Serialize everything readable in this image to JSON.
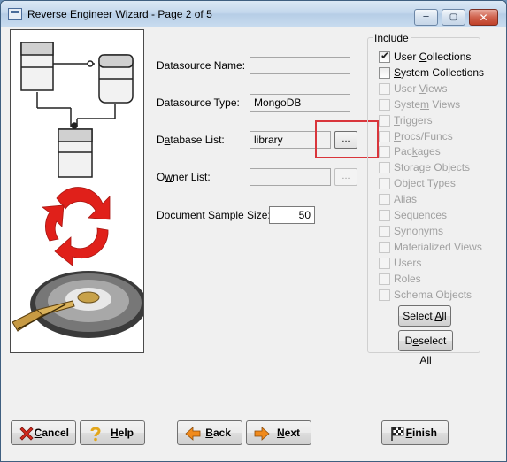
{
  "window": {
    "title": "Reverse Engineer Wizard - Page 2 of 5",
    "controls": {
      "minimize": "─",
      "maximize": "▢",
      "close": "✕"
    }
  },
  "form": {
    "datasource_name": {
      "label": "Datasource Name:",
      "value": ""
    },
    "datasource_type": {
      "label": "Datasource Type:",
      "value": "MongoDB"
    },
    "database_list": {
      "label_pre": "D",
      "label_u": "a",
      "label_post": "tabase List:",
      "value": "library",
      "browse": "..."
    },
    "owner_list": {
      "label_pre": "O",
      "label_u": "w",
      "label_post": "ner List:",
      "value": "",
      "browse": "..."
    },
    "sample_size": {
      "label": "Document Sample Size:",
      "value": "50"
    }
  },
  "include": {
    "title": "Include",
    "items": [
      {
        "pre": "User ",
        "u": "C",
        "post": "ollections",
        "checked": true,
        "enabled": true
      },
      {
        "pre": "",
        "u": "S",
        "post": "ystem Collections",
        "checked": false,
        "enabled": true
      },
      {
        "pre": "User ",
        "u": "V",
        "post": "iews",
        "checked": false,
        "enabled": false
      },
      {
        "pre": "Syste",
        "u": "m",
        "post": " Views",
        "checked": false,
        "enabled": false
      },
      {
        "pre": "",
        "u": "T",
        "post": "riggers",
        "checked": false,
        "enabled": false
      },
      {
        "pre": "",
        "u": "P",
        "post": "rocs/Funcs",
        "checked": false,
        "enabled": false
      },
      {
        "pre": "Pac",
        "u": "k",
        "post": "ages",
        "checked": false,
        "enabled": false
      },
      {
        "pre": "Storage Objects",
        "u": "",
        "post": "",
        "checked": false,
        "enabled": false
      },
      {
        "pre": "Object Types",
        "u": "",
        "post": "",
        "checked": false,
        "enabled": false
      },
      {
        "pre": "Alias",
        "u": "",
        "post": "",
        "checked": false,
        "enabled": false
      },
      {
        "pre": "Sequences",
        "u": "",
        "post": "",
        "checked": false,
        "enabled": false
      },
      {
        "pre": "Synonyms",
        "u": "",
        "post": "",
        "checked": false,
        "enabled": false
      },
      {
        "pre": "Materialized Views",
        "u": "",
        "post": "",
        "checked": false,
        "enabled": false
      },
      {
        "pre": "Users",
        "u": "",
        "post": "",
        "checked": false,
        "enabled": false
      },
      {
        "pre": "Roles",
        "u": "",
        "post": "",
        "checked": false,
        "enabled": false
      },
      {
        "pre": "Schema Objects",
        "u": "",
        "post": "",
        "checked": false,
        "enabled": false
      }
    ],
    "select_all": {
      "pre": "Select ",
      "u": "A",
      "post": "ll"
    },
    "deselect_all": {
      "pre": "D",
      "u": "e",
      "post": "select All"
    }
  },
  "footer": {
    "cancel": {
      "pre": "",
      "u": "C",
      "post": "ancel",
      "icon": "cancel-x-icon"
    },
    "help": {
      "pre": "",
      "u": "H",
      "post": "elp",
      "icon": "question-mark-icon"
    },
    "back": {
      "pre": "",
      "u": "B",
      "post": "ack",
      "icon": "left-arrow-icon"
    },
    "next": {
      "pre": "",
      "u": "N",
      "post": "ext",
      "icon": "right-arrow-icon"
    },
    "finish": {
      "pre": "",
      "u": "F",
      "post": "inish",
      "icon": "checkered-flag-icon"
    }
  },
  "colors": {
    "highlight": "#d9353b",
    "arrow_orange": "#f08a1c",
    "cycle_red": "#e0201a"
  }
}
